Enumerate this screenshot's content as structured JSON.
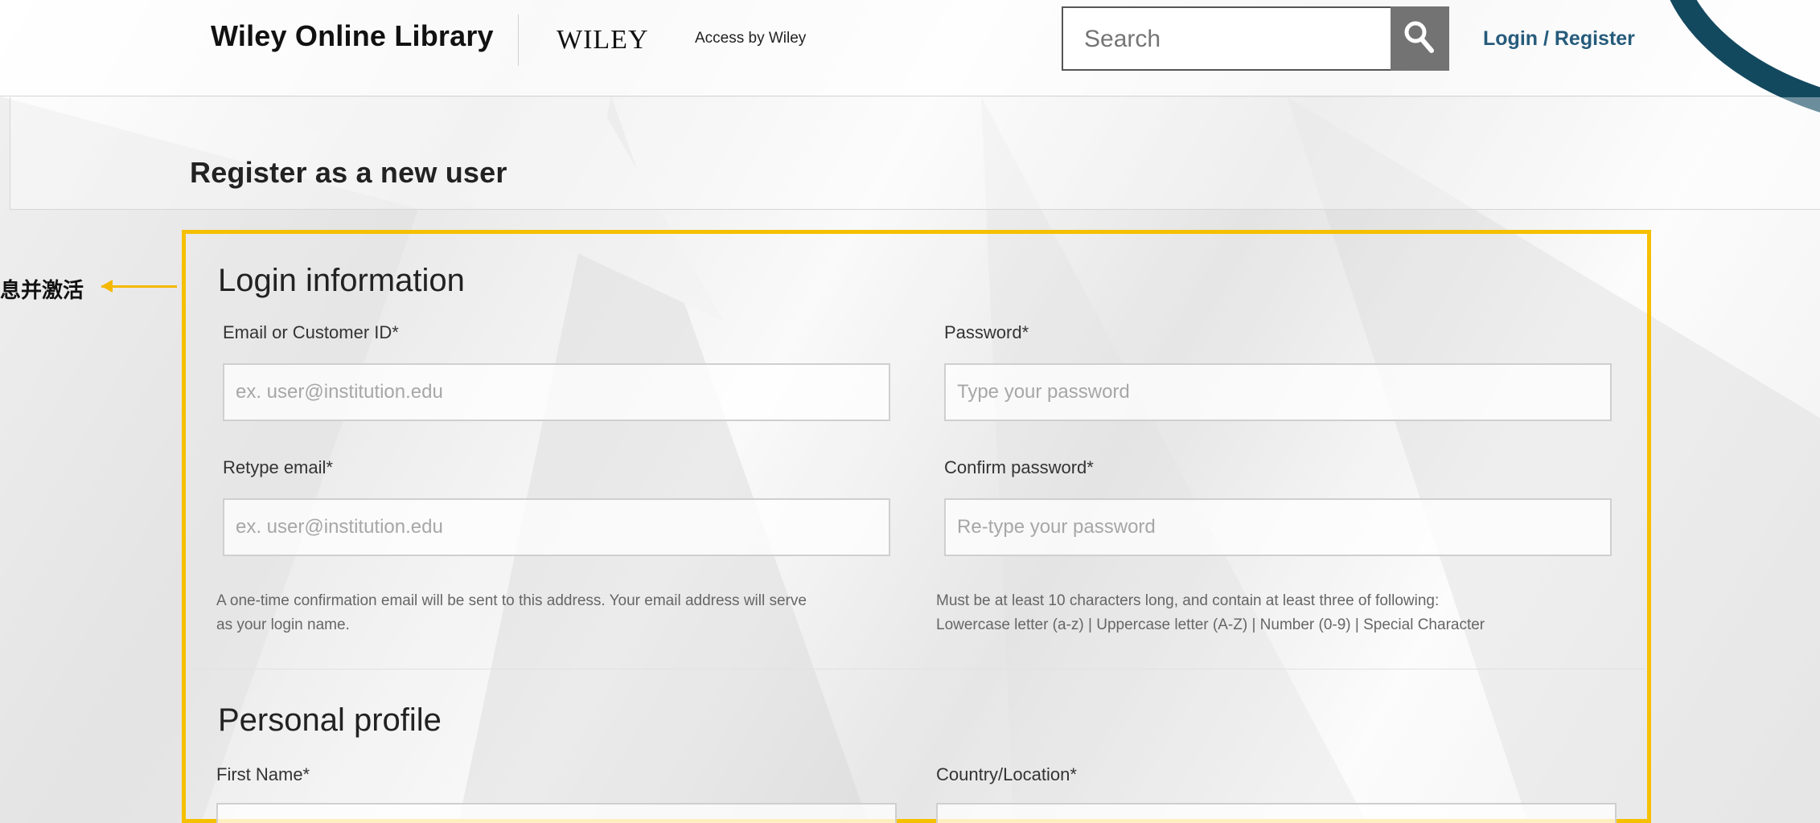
{
  "header": {
    "site_name": "Wiley Online Library",
    "publisher_logo": "WILEY",
    "access_by": "Access by Wiley",
    "search": {
      "placeholder": "Search",
      "button_icon": "search-icon"
    },
    "login_register": "Login / Register"
  },
  "page": {
    "title": "Register as a new user"
  },
  "annotation": {
    "text": "息并激活",
    "arrow_color": "#f5b800"
  },
  "login_information": {
    "title": "Login information",
    "email_label": "Email or Customer ID*",
    "email_placeholder": "ex. user@institution.edu",
    "password_label": "Password*",
    "password_placeholder": "Type your password",
    "retype_email_label": "Retype email*",
    "retype_email_placeholder": "ex. user@institution.edu",
    "confirm_password_label": "Confirm password*",
    "confirm_password_placeholder": "Re-type your password",
    "email_help_line1": "A one-time confirmation email will be sent to this address. Your email address will serve",
    "email_help_line2": "as your login name.",
    "password_help_line1": "Must be at least 10 characters long, and contain at least three of following:",
    "password_help_line2": "Lowercase letter (a-z) | Uppercase letter (A-Z) | Number (0-9) | Special Character"
  },
  "personal_profile": {
    "title": "Personal profile",
    "first_name_label": "First Name*",
    "first_name_value": "",
    "country_label": "Country/Location*",
    "country_value": ""
  },
  "colors": {
    "highlight": "#f5c000",
    "link": "#265b7b",
    "search_button": "#737373",
    "corner_accent": "#13495f"
  }
}
